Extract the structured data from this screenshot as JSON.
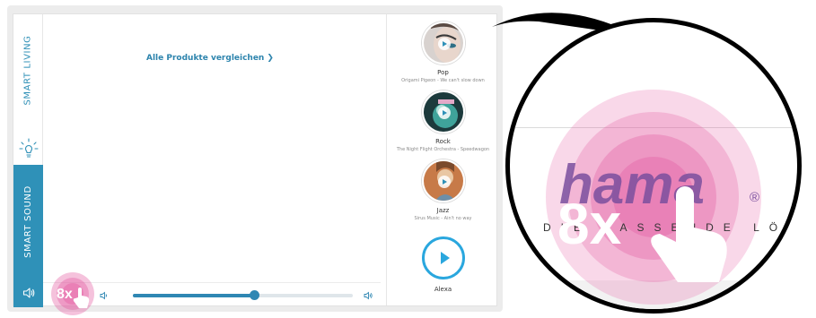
{
  "sidebar": {
    "smart_living_label": "SMART LIVING",
    "smart_sound_label": "SMART SOUND",
    "bulb_icon": "lightbulb-icon",
    "speaker_icon": "speaker-icon"
  },
  "main": {
    "compare_link": "Alle Produkte vergleichen",
    "compare_arrow": "❯"
  },
  "player": {
    "volume_level": 0.55,
    "volume_min_icon": "speaker-low-icon",
    "volume_max_icon": "speaker-high-icon"
  },
  "stations": [
    {
      "name": "Pop",
      "subtitle": "Origami Pigeon - We can't slow down",
      "color": "#c9c2bf"
    },
    {
      "name": "Rock",
      "subtitle": "The Night Flight Orchestra - Speedwagon",
      "color": "#2e8f8a"
    },
    {
      "name": "Jazz",
      "subtitle": "Sirus Music - Ain't no way",
      "color": "#d68e5a"
    },
    {
      "name": "Alexa",
      "subtitle": "",
      "color": "#2aa7de"
    }
  ],
  "badge": {
    "count": "8x",
    "brand": "hama",
    "registered": "®",
    "tagline": "DIE PASSENDE LÖSUNG"
  },
  "colors": {
    "accent": "#2f91b8",
    "badge_pink": "#e24f9a",
    "brand_purple": "#7b4f9e"
  }
}
